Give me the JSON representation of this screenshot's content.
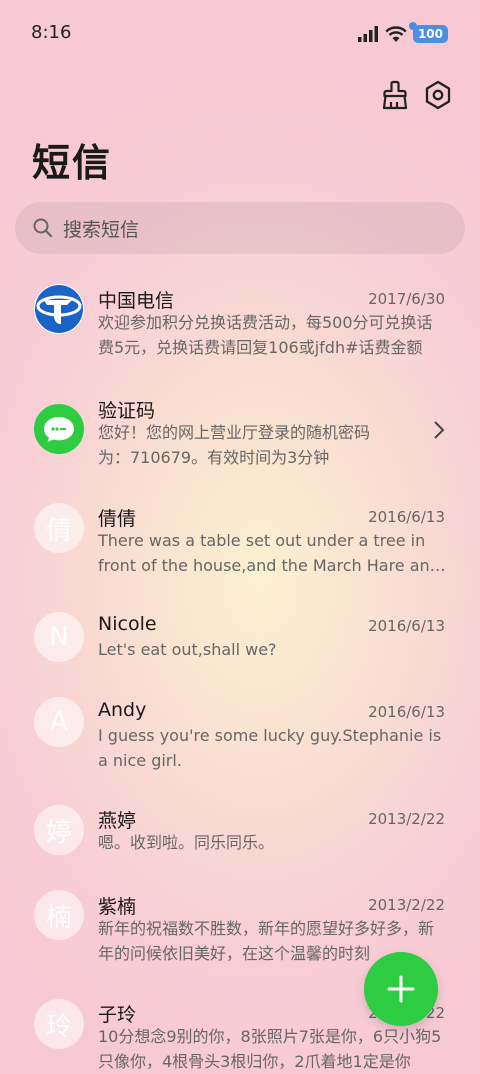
{
  "status_bar": {
    "time": "8:16",
    "battery": "100"
  },
  "header": {
    "title": "短信"
  },
  "search": {
    "placeholder": "搜索短信"
  },
  "conversations": [
    {
      "name": "中国电信",
      "date": "2017/6/30",
      "preview": "欢迎参加积分兑换话费活动，每500分可兑换话费5元，兑换话费请回复106或jfdh#话费金额",
      "avatar": "telecom-logo"
    },
    {
      "name": "验证码",
      "date": "",
      "preview": "您好！您的网上营业厅登录的随机密码为：710679。有效时间为3分钟",
      "avatar": "message-icon"
    },
    {
      "name": "倩倩",
      "date": "2016/6/13",
      "preview": "There was a table set out under a tree in front of the house,and the March Hare and the Hatter",
      "avatar_letter": "倩"
    },
    {
      "name": "Nicole",
      "date": "2016/6/13",
      "preview": "Let's eat out,shall we?",
      "avatar_letter": "N"
    },
    {
      "name": "Andy",
      "date": "2016/6/13",
      "preview": "I guess you're some lucky guy.Stephanie is a nice girl.",
      "avatar_letter": "A"
    },
    {
      "name": "燕婷",
      "date": "2013/2/22",
      "preview": "嗯。收到啦。同乐同乐。",
      "avatar_letter": "婷"
    },
    {
      "name": "紫楠",
      "date": "2013/2/22",
      "preview": "新年的祝福数不胜数，新年的愿望好多好多，新年的问候依旧美好，在这个温馨的时刻",
      "avatar_letter": "楠"
    },
    {
      "name": "子玲",
      "date": "2013/2/22",
      "preview": "10分想念9别的你，8张照片7张是你，6只小狗5只像你，4根骨头3根归你，2爪着地1定是你",
      "avatar_letter": "玲"
    }
  ],
  "colors": {
    "accent": "#2ecc40",
    "telecom_blue": "#1a64c8"
  }
}
